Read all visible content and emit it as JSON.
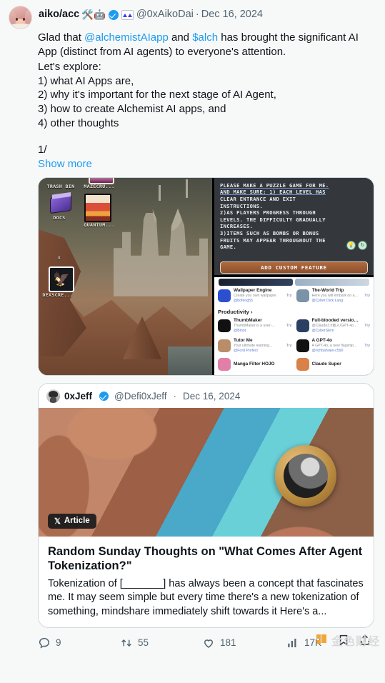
{
  "tweet": {
    "author": {
      "display_name": "aiko/acc",
      "emoji": "🛠️🤖",
      "verified_badge": "verified-blue",
      "affiliate_badge": "affiliate-square",
      "handle": "@0xAikoDai",
      "separator": "·",
      "date": "Dec 16, 2024"
    },
    "body": {
      "line1_pre": "Glad that ",
      "mention": "@alchemistAIapp",
      "line1_mid": " and ",
      "cashtag": "$alch",
      "line1_post": " has brought the significant AI App (distinct from AI agents) to everyone's attention.",
      "paragraph2": "Let's explore:\n1) what AI Apps are,\n2) why it's important for the next stage of AI Agent,\n3) how to create Alchemist AI apps, and\n4) other thoughts",
      "paragraph3": "1/",
      "show_more": "Show more"
    },
    "media": {
      "left_desktop": {
        "icons": [
          {
            "label": "TRASH BIN"
          },
          {
            "label": "MAZECRU..."
          },
          {
            "label": "DOCS"
          },
          {
            "label": "QUANTUM..."
          },
          {
            "label": "X"
          },
          {
            "label": "DEXSCRE..."
          }
        ]
      },
      "right_prompt": {
        "lines": [
          "PLEASE MAKE A PUZZLE GAME FOR ME.",
          "AND MAKE SURE: 1) EACH LEVEL HAS",
          "CLEAR ENTRANCE AND EXIT",
          "INSTRUCTIONS.",
          "2)AS PLAYERS PROGRESS THROUGH",
          "LEVELS. THE DIFFICULTY GRADUALLY",
          "INCREASES.",
          "3)ITEMS SUCH AS BOMBS OR BONUS",
          "FRUITS MAY APPEAR THROUGHOUT THE",
          "GAME."
        ],
        "button": "ADD CUSTOM FEATURE"
      },
      "right_store": {
        "category": "Productivity ›",
        "try_label": "Try",
        "rows": [
          [
            {
              "name": "Wallpaper Engine",
              "desc": "Create you own wallpaper",
              "author": "@bofeng55",
              "color": "#2c4fd0"
            },
            {
              "name": "The-World Trip",
              "desc": "Here you will embark on a...",
              "author": "@Cyber Dick Lang",
              "color": "#7a93a8"
            }
          ],
          [
            {
              "name": "ThumbMaker",
              "desc": "ThumbMaker is a user-...",
              "author": "@Binot",
              "color": "#111111"
            },
            {
              "name": "Full-blooded version o...",
              "desc": "@Claude3.5嵌入/GPT-4o...",
              "author": "@CyberSlem",
              "color": "#2b3f63"
            }
          ],
          [
            {
              "name": "Tutor Me",
              "desc": "Your ultimate learning...",
              "author": "@Ford Prefect",
              "color": "#b98d6a"
            },
            {
              "name": "A GPT-4o",
              "desc": "A GPT-4o, a new flagship...",
              "author": "@richbahrain-c590",
              "color": "#111111"
            }
          ],
          [
            {
              "name": "Manga Filter HOJO",
              "desc": "",
              "author": "",
              "color": "#e07fa8"
            },
            {
              "name": "Claude Super",
              "desc": "",
              "author": "",
              "color": "#d8824a"
            }
          ]
        ]
      }
    },
    "quoted": {
      "display_name": "0xJeff",
      "handle": "@Defi0xJeff",
      "separator": "·",
      "date": "Dec 16, 2024",
      "article_badge": "Article",
      "title": "Random Sunday Thoughts on \"What Comes After Agent Tokenization?\"",
      "text": "Tokenization of [_______] has always been a concept that fascinates me. It may seem simple but every time there's a new tokenization of something, mindshare immediately shift towards it Here's a..."
    },
    "actions": {
      "replies": "9",
      "reposts": "55",
      "likes": "181",
      "views": "17K"
    },
    "watermark": {
      "text": "金色财经"
    }
  }
}
